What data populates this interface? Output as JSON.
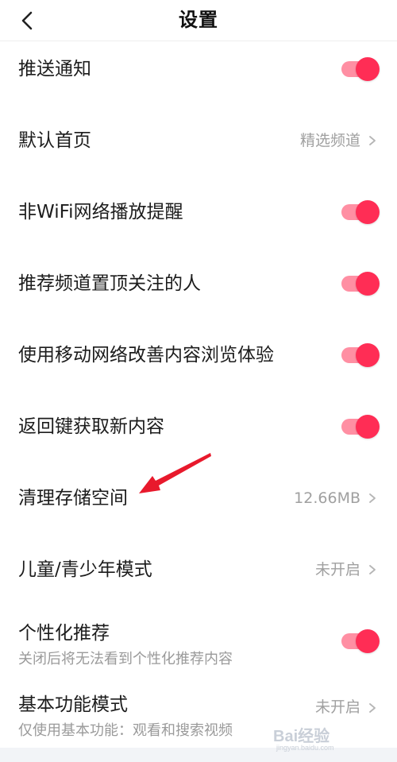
{
  "header": {
    "title": "设置",
    "back_icon": "chevron-left-icon"
  },
  "settings": [
    {
      "key": "push",
      "label": "推送通知",
      "type": "toggle",
      "enabled": true
    },
    {
      "key": "home",
      "label": "默认首页",
      "type": "link",
      "value": "精选频道"
    },
    {
      "key": "nonwifi",
      "label": "非WiFi网络播放提醒",
      "type": "toggle",
      "enabled": true
    },
    {
      "key": "pin",
      "label": "推荐频道置顶关注的人",
      "type": "toggle",
      "enabled": true
    },
    {
      "key": "mobile",
      "label": "使用移动网络改善内容浏览体验",
      "type": "toggle",
      "enabled": true
    },
    {
      "key": "backkey",
      "label": "返回键获取新内容",
      "type": "toggle",
      "enabled": true
    },
    {
      "key": "storage",
      "label": "清理存储空间",
      "type": "link",
      "value": "12.66MB"
    },
    {
      "key": "teen",
      "label": "儿童/青少年模式",
      "type": "link",
      "value": "未开启"
    },
    {
      "key": "personal",
      "label": "个性化推荐",
      "sublabel": "关闭后将无法看到个性化推荐内容",
      "type": "toggle",
      "enabled": true
    },
    {
      "key": "basic",
      "label": "基本功能模式",
      "sublabel": "仅使用基本功能：观看和搜索视频",
      "type": "link",
      "value": "未开启"
    }
  ],
  "colors": {
    "toggle_knob": "#ff2d55",
    "toggle_track": "#ff8fa3",
    "annotation_arrow": "#e8192c"
  },
  "watermark": {
    "main": "Bai经验",
    "sub": "jingyan.baidu.com"
  }
}
